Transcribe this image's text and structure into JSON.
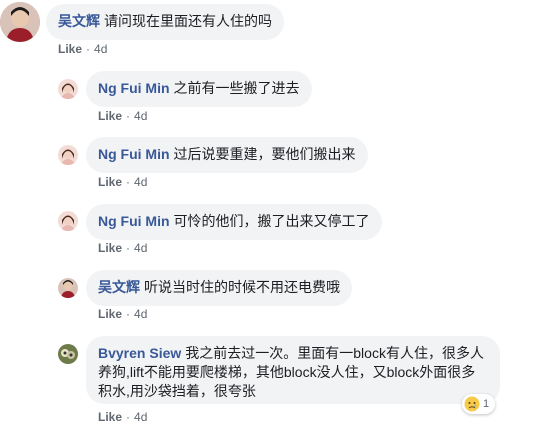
{
  "comments": [
    {
      "author": "吴文辉",
      "text": "请问现在里面还有人住的吗",
      "like": "Like",
      "time": "4d"
    },
    {
      "author": "Ng Fui Min",
      "text": "之前有一些搬了进去",
      "like": "Like",
      "time": "4d"
    },
    {
      "author": "Ng Fui Min",
      "text": "过后说要重建，要他们搬出来",
      "like": "Like",
      "time": "4d"
    },
    {
      "author": "Ng Fui Min",
      "text": "可怜的他们，搬了出来又停工了",
      "like": "Like",
      "time": "4d"
    },
    {
      "author": "吴文辉",
      "text": "听说当时住的时候不用还电费哦",
      "like": "Like",
      "time": "4d"
    },
    {
      "author": "Bvyren Siew",
      "text": "我之前去过一次。里面有一block有人住，很多人养狗,lift不能用要爬楼梯，其他block没人住，又block外面很多积水,用沙袋挡着，很夸张",
      "like": "Like",
      "time": "4d",
      "reaction_count": "1"
    }
  ],
  "colors": {
    "bubble": "#f2f3f5",
    "author": "#385898",
    "meta": "#606770"
  }
}
